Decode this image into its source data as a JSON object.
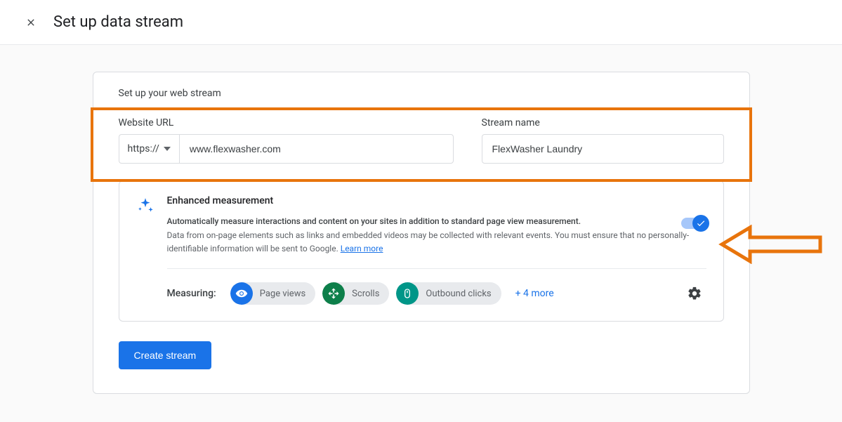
{
  "header": {
    "title": "Set up data stream"
  },
  "card": {
    "subtitle": "Set up your web stream",
    "url_label": "Website URL",
    "protocol": "https://",
    "url_value": "www.flexwasher.com",
    "name_label": "Stream name",
    "name_value": "FlexWasher Laundry"
  },
  "enhanced": {
    "title": "Enhanced measurement",
    "subtitle": "Automatically measure interactions and content on your sites in addition to standard page view measurement.",
    "description": "Data from on-page elements such as links and embedded videos may be collected with relevant events. You must ensure that no personally-identifiable information will be sent to Google. ",
    "learn_more": "Learn more",
    "toggle_on": true
  },
  "measuring": {
    "label": "Measuring:",
    "pills": [
      {
        "label": "Page views",
        "color": "blue",
        "icon": "eye"
      },
      {
        "label": "Scrolls",
        "color": "green",
        "icon": "scroll"
      },
      {
        "label": "Outbound clicks",
        "color": "teal",
        "icon": "mouse"
      }
    ],
    "more": "+ 4 more"
  },
  "create_button": "Create stream",
  "annotations": {
    "orange_box_color": "#e8740c",
    "arrow_color": "#e8740c"
  }
}
